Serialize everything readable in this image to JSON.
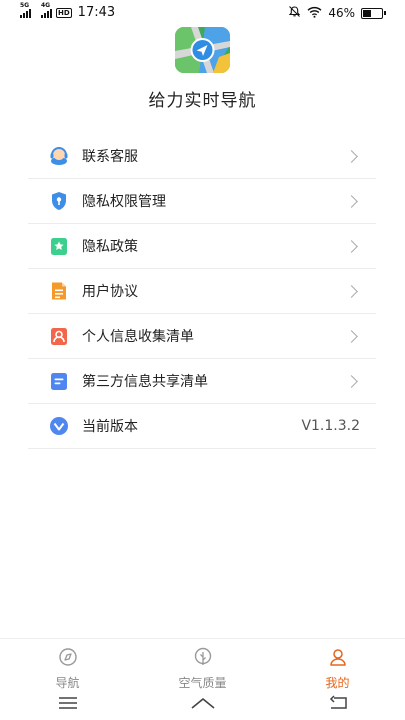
{
  "status_bar": {
    "network_1": "5G",
    "network_2": "4G",
    "hd": "HD",
    "time": "17:43",
    "battery_percent": "46%",
    "battery_level": 0.46,
    "icons": [
      "signal-icon",
      "hd-icon",
      "mute-icon",
      "wifi-icon",
      "battery-icon"
    ]
  },
  "header": {
    "logo": "navigation-app-logo",
    "title": "给力实时导航"
  },
  "menu": {
    "items": [
      {
        "label": "联系客服",
        "icon": "customer-service-icon",
        "color": "#3e8ee8"
      },
      {
        "label": "隐私权限管理",
        "icon": "privacy-shield-icon",
        "color": "#3e8ee8"
      },
      {
        "label": "隐私政策",
        "icon": "policy-star-icon",
        "color": "#3ccf8e"
      },
      {
        "label": "用户协议",
        "icon": "user-agreement-icon",
        "color": "#f49a2b"
      },
      {
        "label": "个人信息收集清单",
        "icon": "personal-info-icon",
        "color": "#f2674b"
      },
      {
        "label": "第三方信息共享清单",
        "icon": "third-party-list-icon",
        "color": "#4f86f0"
      },
      {
        "label": "当前版本",
        "icon": "version-icon",
        "color": "#4f86f0",
        "value": "V1.1.3.2"
      }
    ]
  },
  "tabs": [
    {
      "label": "导航",
      "icon": "compass-icon",
      "active": false
    },
    {
      "label": "空气质量",
      "icon": "leaf-icon",
      "active": false
    },
    {
      "label": "我的",
      "icon": "profile-icon",
      "active": true
    }
  ],
  "colors": {
    "accent": "#e8641b",
    "inactive_tab": "#888888",
    "divider": "#ececec"
  },
  "system_nav": [
    "menu-icon",
    "home-icon",
    "back-icon"
  ]
}
